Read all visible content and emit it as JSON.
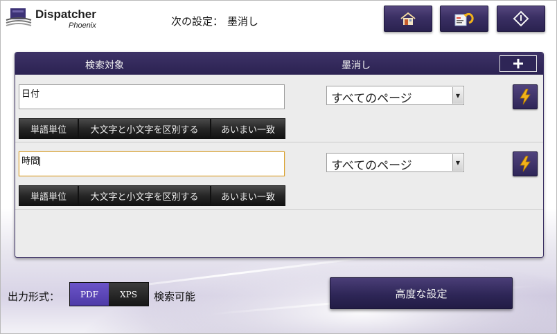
{
  "header": {
    "app_name": "Dispatcher",
    "app_sub": "Phoenix",
    "next_setting_label": "次の設定：",
    "next_setting_value": "墨消し",
    "buttons": [
      {
        "name": "home-button",
        "icon": "home-icon"
      },
      {
        "name": "edit-back-button",
        "icon": "form-undo-icon"
      },
      {
        "name": "start-button",
        "icon": "start-diamond-icon"
      }
    ]
  },
  "panel": {
    "col_target": "検索対象",
    "col_redact": "墨消し",
    "add_icon": "plus-icon",
    "rows": [
      {
        "term": "日付",
        "scope": "すべてのページ",
        "options": [
          "単語単位",
          "大文字と小文字を区別する",
          "あいまい一致"
        ],
        "focused": false
      },
      {
        "term": "時間",
        "scope": "すべてのページ",
        "options": [
          "単語単位",
          "大文字と小文字を区別する",
          "あいまい一致"
        ],
        "focused": true
      }
    ]
  },
  "footer": {
    "format_label": "出力形式：",
    "format_pdf": "PDF",
    "format_xps": "XPS",
    "format_selected": "PDF",
    "searchable_label": "検索可能",
    "advanced_button": "高度な設定"
  },
  "colors": {
    "accent": "#2e2556",
    "selected_format": "#5a44b8",
    "focus_border": "#d9a230",
    "bolt": "#f2b21a"
  }
}
